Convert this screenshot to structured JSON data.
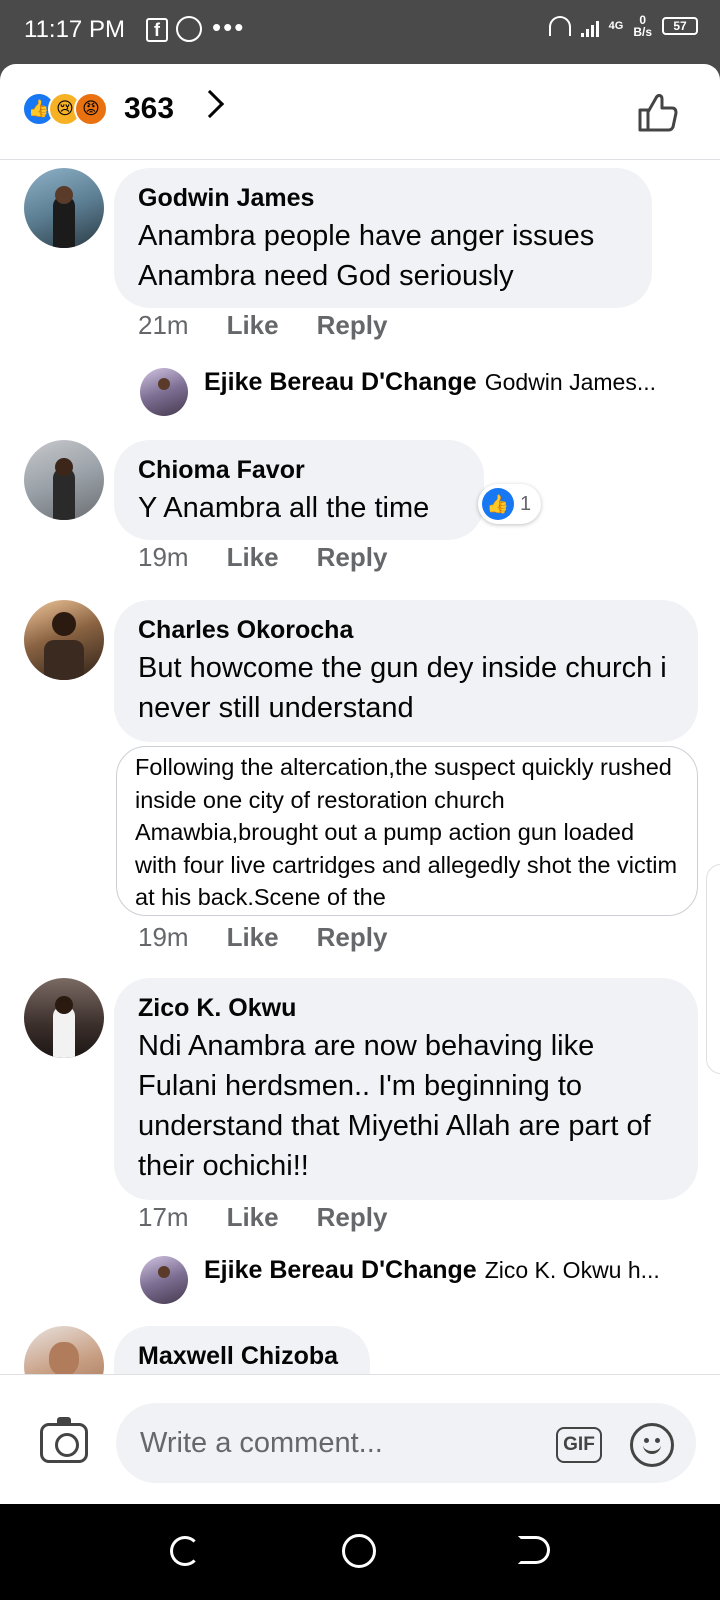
{
  "status_bar": {
    "time": "11:17 PM",
    "network": "4G",
    "speed_value": "0",
    "speed_unit": "B/s",
    "battery": "57"
  },
  "header": {
    "reaction_icons": [
      "like-icon",
      "sad-icon",
      "angry-icon"
    ],
    "reaction_count": "363"
  },
  "comments": [
    {
      "author": "Godwin James",
      "text": "Anambra people have anger issues Anambra need God seriously",
      "time": "21m",
      "like_label": "Like",
      "reply_label": "Reply",
      "reply_preview": {
        "author": "Ejike Bereau D'Change",
        "text": "Godwin James..."
      }
    },
    {
      "author": "Chioma Favor",
      "text": "Y Anambra all the time",
      "time": "19m",
      "like_label": "Like",
      "reply_label": "Reply",
      "reaction_count": "1"
    },
    {
      "author": "Charles Okorocha",
      "text": "But howcome the gun dey inside church i never still understand",
      "attachment_text": "Following the altercation,the suspect quickly rushed inside one city of restoration church Amawbia,brought out  a pump action gun loaded with four live cartridges and allegedly shot the victim at his back.Scene of the",
      "time": "19m",
      "like_label": "Like",
      "reply_label": "Reply"
    },
    {
      "author": "Zico K. Okwu",
      "text": "Ndi Anambra are now behaving like Fulani herdsmen.. I'm beginning to understand that Miyethi Allah are part of their ochichi!!",
      "time": "17m",
      "like_label": "Like",
      "reply_label": "Reply",
      "reply_preview": {
        "author": "Ejike Bereau D'Change",
        "text": "Zico K. Okwu h..."
      }
    },
    {
      "author": "Maxwell Chizoba"
    }
  ],
  "composer": {
    "placeholder": "Write a comment...",
    "gif_label": "GIF"
  },
  "colors": {
    "accent": "#1877f2",
    "bubble": "#f0f2f5",
    "meta_text": "#65676b",
    "status_bar": "#4a4a4a"
  }
}
